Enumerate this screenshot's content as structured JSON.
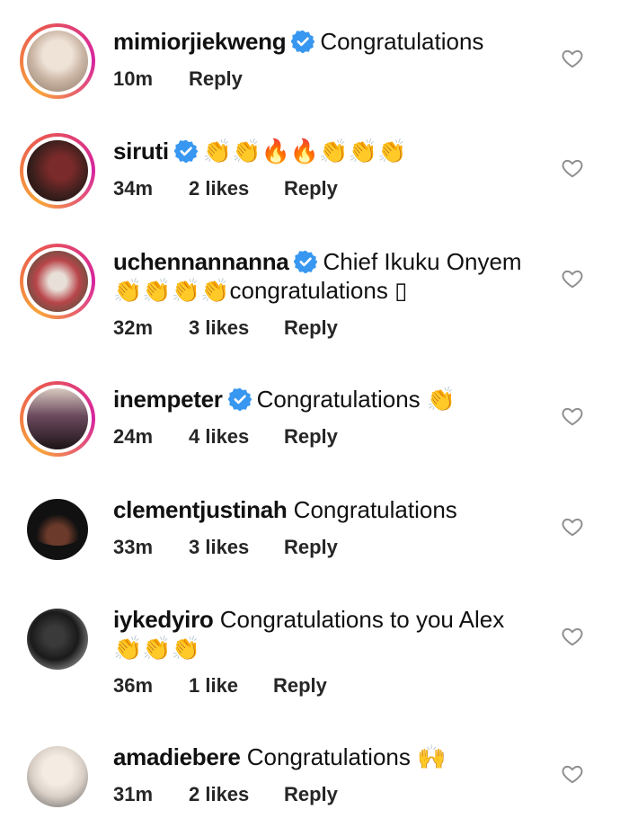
{
  "comments": [
    {
      "username": "mimiorjiekweng",
      "verified": true,
      "text": "Congratulations",
      "emoji": "",
      "time": "10m",
      "likes": "",
      "reply": "Reply",
      "avatar_color": "#c9b3a2"
    },
    {
      "username": "siruti",
      "verified": true,
      "text": "",
      "emoji": "👏👏🔥🔥👏👏👏",
      "time": "34m",
      "likes": "2 likes",
      "reply": "Reply",
      "avatar_color": "#3a1f1c"
    },
    {
      "username": "uchennannanna",
      "verified": true,
      "text": "Chief Ikuku Onyem",
      "text2": "congratulations ▯",
      "emoji": "👏👏👏👏",
      "time": "32m",
      "likes": "3 likes",
      "reply": "Reply",
      "avatar_color": "#b8454a"
    },
    {
      "username": "inempeter",
      "verified": true,
      "text": "Congratulations",
      "emoji": "👏",
      "time": "24m",
      "likes": "4 likes",
      "reply": "Reply",
      "avatar_color": "#6b4a5d"
    },
    {
      "username": "clementjustinah",
      "verified": false,
      "text": "Congratulations",
      "emoji": "",
      "time": "33m",
      "likes": "3 likes",
      "reply": "Reply",
      "avatar_color": "#111111"
    },
    {
      "username": "iykedyiro",
      "verified": false,
      "text": "Congratulations to you Alex",
      "emoji": "👏👏👏",
      "time": "36m",
      "likes": "1 like",
      "reply": "Reply",
      "avatar_color": "#1a1a1a"
    },
    {
      "username": "amadiebere",
      "verified": false,
      "text": "Congratulations",
      "emoji": "🙌",
      "time": "31m",
      "likes": "2 likes",
      "reply": "Reply",
      "avatar_color": "#d9cfc6"
    }
  ],
  "colors": {
    "verified_blue": "#3897f0",
    "emoji_yellow": "#f5c518"
  }
}
